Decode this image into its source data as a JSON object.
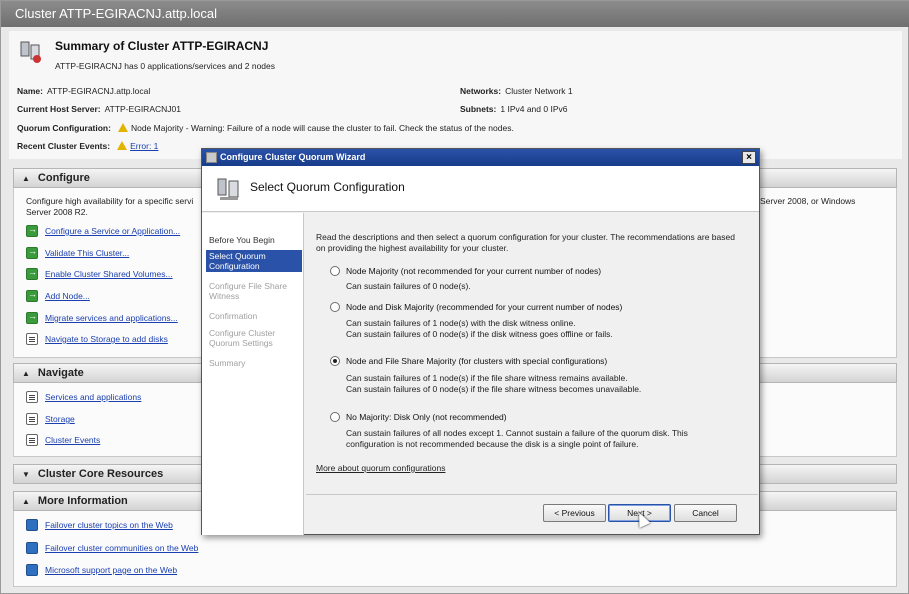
{
  "window": {
    "title": "Cluster ATTP-EGIRACNJ.attp.local"
  },
  "summary": {
    "heading": "Summary of Cluster ATTP-EGIRACNJ",
    "subtitle": "ATTP-EGIRACNJ has 0 applications/services and 2 nodes",
    "name_label": "Name:",
    "name_value": "ATTP-EGIRACNJ.attp.local",
    "host_label": "Current Host Server:",
    "host_value": "ATTP-EGIRACNJ01",
    "networks_label": "Networks:",
    "networks_value": "Cluster Network 1",
    "subnets_label": "Subnets:",
    "subnets_value": "1 IPv4 and 0 IPv6",
    "quorum_label": "Quorum Configuration:",
    "quorum_value": "Node Majority - Warning: Failure of a node will cause the cluster to fail. Check the status of the nodes.",
    "events_label": "Recent Cluster Events:",
    "events_link": "Error: 1"
  },
  "configure": {
    "title": "Configure",
    "desc_left": "Configure high availability for a specific servi",
    "desc_left_2": "Server 2008 R2.",
    "desc_right": "Server 2008, or Windows",
    "tasks": [
      "Configure a Service or Application...",
      "Validate This Cluster...",
      "Enable Cluster Shared Volumes...",
      "Add Node...",
      "Migrate services and applications...",
      "Navigate to Storage to add disks"
    ]
  },
  "navigate": {
    "title": "Navigate",
    "links": [
      "Services and applications",
      "Storage",
      "Cluster Events"
    ]
  },
  "core": {
    "title": "Cluster Core Resources"
  },
  "moreinfo": {
    "title": "More Information",
    "links": [
      "Failover cluster topics on the Web",
      "Failover cluster communities on the Web",
      "Microsoft support page on the Web"
    ]
  },
  "wizard": {
    "title": "Configure Cluster Quorum Wizard",
    "heading": "Select Quorum Configuration",
    "steps": [
      "Before You Begin",
      "Select Quorum Configuration",
      "Configure File Share Witness",
      "Confirmation",
      "Configure Cluster Quorum Settings",
      "Summary"
    ],
    "intro": "Read the descriptions and then select a quorum configuration for your cluster. The recommendations are based on providing the highest availability for your cluster.",
    "options": [
      {
        "label": "Node Majority (not recommended for your current number of nodes)",
        "desc": [
          "Can sustain failures of 0 node(s)."
        ],
        "selected": false
      },
      {
        "label": "Node and Disk Majority (recommended for your current number of nodes)",
        "desc": [
          "Can sustain failures of 1 node(s) with the disk witness online.",
          "Can sustain failures of 0 node(s) if the disk witness goes offline or fails."
        ],
        "selected": false
      },
      {
        "label": "Node and File Share Majority (for clusters with special configurations)",
        "desc": [
          "Can sustain failures of 1 node(s) if the file share witness remains available.",
          "Can sustain failures of 0 node(s) if the file share witness becomes unavailable."
        ],
        "selected": true
      },
      {
        "label": "No Majority: Disk Only (not recommended)",
        "desc": [
          "Can sustain failures of all nodes except 1. Cannot sustain a failure of the quorum disk. This",
          "configuration is not recommended because the disk is a single point of failure."
        ],
        "selected": false
      }
    ],
    "more_link": "More about quorum configurations",
    "buttons": {
      "previous": "< Previous",
      "next": "Next >",
      "cancel": "Cancel"
    },
    "close_glyph": "×"
  },
  "colors": {
    "titlebar": "#2a52a8",
    "selected_step": "#2a52a8",
    "link": "#1a3fb0",
    "warning": "#e2b400"
  }
}
